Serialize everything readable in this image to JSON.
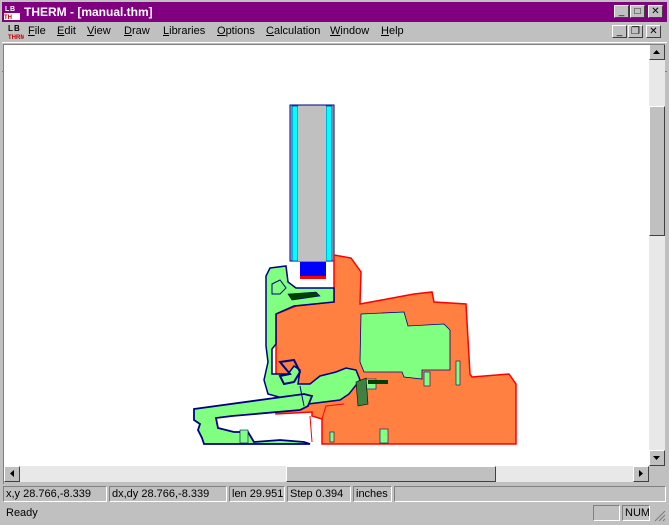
{
  "window": {
    "title": "THERM - [manual.thm]"
  },
  "menus": [
    {
      "label": "File",
      "key": "F",
      "rest": "ile"
    },
    {
      "label": "Edit",
      "key": "E",
      "rest": "dit"
    },
    {
      "label": "View",
      "key": "V",
      "rest": "iew"
    },
    {
      "label": "Draw",
      "key": "D",
      "rest": "raw"
    },
    {
      "label": "Libraries",
      "key": "L",
      "rest": "ibraries"
    },
    {
      "label": "Options",
      "key": "O",
      "rest": "ptions"
    },
    {
      "label": "Calculation",
      "key": "C",
      "rest": "alculation"
    },
    {
      "label": "Window",
      "key": "W",
      "rest": "indow"
    },
    {
      "label": "Help",
      "key": "H",
      "rest": "elp"
    }
  ],
  "toolbar": {
    "buttons": [
      "new-file",
      "open-file",
      "save-file",
      "print",
      "polygon",
      "rectangle",
      "fill-void",
      "locate",
      "insulation-shape",
      "add-point",
      "move-point",
      "draw-mode",
      "rotate",
      "zoom",
      "flip",
      "boundary-conditions",
      "calculate",
      "bc-temperature"
    ],
    "combo_value": ""
  },
  "status": {
    "xy": "x,y 28.766,-8.339",
    "dxdy": "dx,dy 28.766,-8.339",
    "len": "len 29.951",
    "step": "Step 0.394",
    "units": "inches",
    "message": "Ready",
    "num": "NUM"
  },
  "colors": {
    "titlebar": "#800080",
    "frame_blue": "#000080",
    "glass_gray": "#c0c0c0",
    "glass_edge": "#00ffff",
    "spacer_blue": "#0000ff",
    "vinyl_green": "#80ff80",
    "wood_orange": "#ff8040",
    "boundary_red": "#ff0000"
  }
}
